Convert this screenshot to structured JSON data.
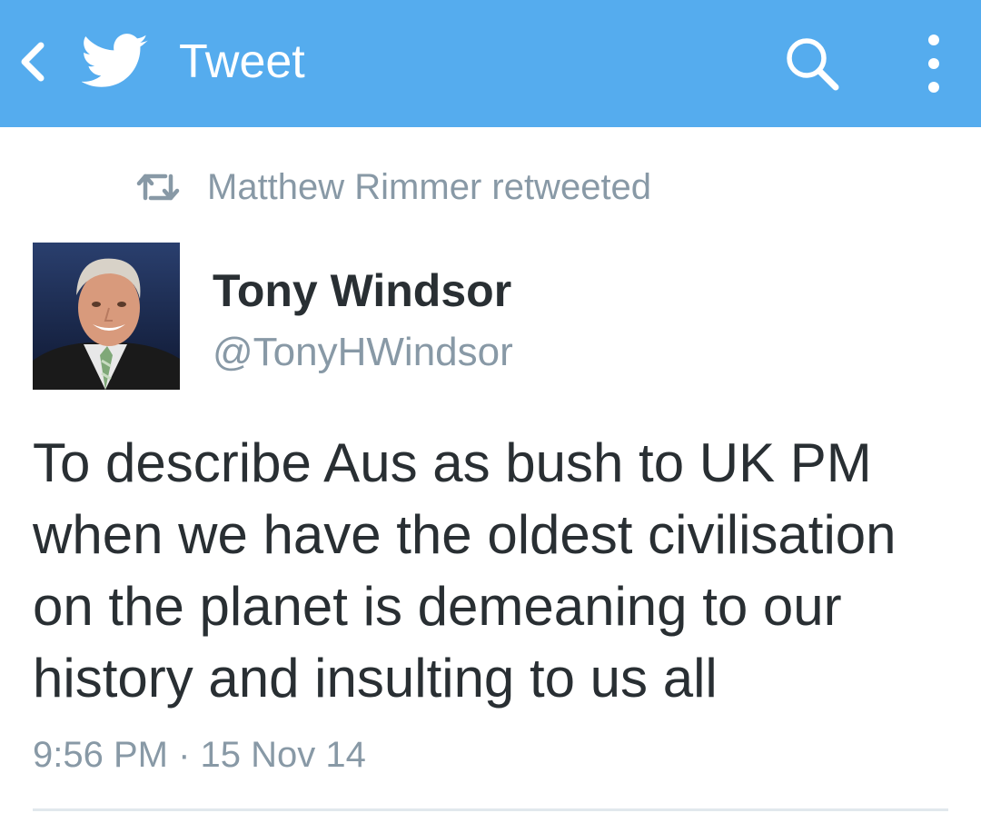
{
  "colors": {
    "appbar_background": "#55acee",
    "text_primary": "#292f33",
    "text_secondary": "#8899a6"
  },
  "appbar": {
    "back_icon": "chevron-left-icon",
    "logo_icon": "twitter-bird-icon",
    "title": "Tweet",
    "search_icon": "search-icon",
    "overflow_icon": "vertical-dots-icon"
  },
  "retweet_context": {
    "icon": "retweet-icon",
    "label": "Matthew Rimmer retweeted"
  },
  "author": {
    "name": "Tony Windsor",
    "handle": "@TonyHWindsor"
  },
  "tweet": {
    "text_lines": [
      "To describe Aus as bush to UK PM",
      "when we have the oldest civilisation",
      "on the planet is demeaning to our",
      "history and insulting to us all"
    ],
    "timestamp": "9:56 PM · 15 Nov 14"
  }
}
